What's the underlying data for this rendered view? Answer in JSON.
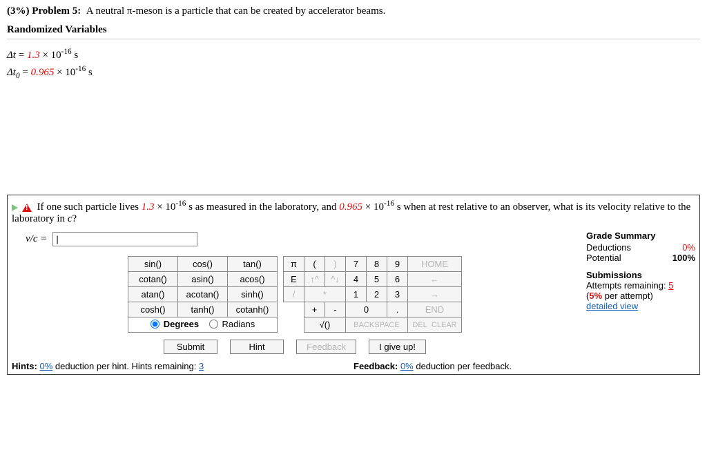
{
  "header": {
    "percent": "(3%)",
    "label": "Problem 5:",
    "desc": "A neutral π-meson is a particle that can be created by accelerator beams."
  },
  "rv": {
    "heading": "Randomized Variables",
    "dt_sym": "Δt",
    "dt_val": "1.3",
    "dt_exp": "-16",
    "dt_unit": "s",
    "dt0_sym": "Δt",
    "dt0_sub": "0",
    "dt0_val": "0.965",
    "dt0_exp": "-16",
    "dt0_unit": "s",
    "times": "× 10"
  },
  "q": {
    "p1": "If one such particle lives ",
    "v1": "1.3",
    "mid1": " × 10",
    "exp": "-16",
    "p2": " s as measured in the laboratory, and ",
    "v2": "0.965",
    "p3": " s when at rest relative to an observer, what is its velocity relative to the laboratory in ",
    "c": "c",
    "qm": "?"
  },
  "answer": {
    "label": "v/c =",
    "value": "|"
  },
  "grade": {
    "heading": "Grade Summary",
    "ded_label": "Deductions",
    "ded_val": "0%",
    "pot_label": "Potential",
    "pot_val": "100%"
  },
  "subm": {
    "heading": "Submissions",
    "att_label": "Attempts remaining:",
    "att_val": "5",
    "per": "(5% per attempt)",
    "detail": "detailed view"
  },
  "fn": {
    "r1c1": "sin()",
    "r1c2": "cos()",
    "r1c3": "tan()",
    "r2c1": "cotan()",
    "r2c2": "asin()",
    "r2c3": "acos()",
    "r3c1": "atan()",
    "r3c2": "acotan()",
    "r3c3": "sinh()",
    "r4c1": "cosh()",
    "r4c2": "tanh()",
    "r4c3": "cotanh()",
    "deg": "Degrees",
    "rad": "Radians"
  },
  "num": {
    "pi": "π",
    "lp": "(",
    "rp": ")",
    "7": "7",
    "8": "8",
    "9": "9",
    "home": "HOME",
    "e": "E",
    "up": "↑^",
    "dn": "^↓",
    "4": "4",
    "5": "5",
    "6": "6",
    "larr": "←",
    "sl": "/",
    "st": "*",
    "1": "1",
    "2": "2",
    "3": "3",
    "rarr": "→",
    "pl": "+",
    "mi": "-",
    "0": "0",
    "dot": ".",
    "end": "END",
    "sq": "√()",
    "bs": "BACKSPACE",
    "del": "DEL",
    "clr": "CLEAR"
  },
  "btns": {
    "submit": "Submit",
    "hint": "Hint",
    "feedback": "Feedback",
    "giveup": "I give up!"
  },
  "foot": {
    "hints_label": "Hints:",
    "hints_pct": "0%",
    "hints_txt": " deduction per hint. Hints remaining: ",
    "hints_rem": "3",
    "fb_label": "Feedback:",
    "fb_pct": "0%",
    "fb_txt": " deduction per feedback."
  }
}
